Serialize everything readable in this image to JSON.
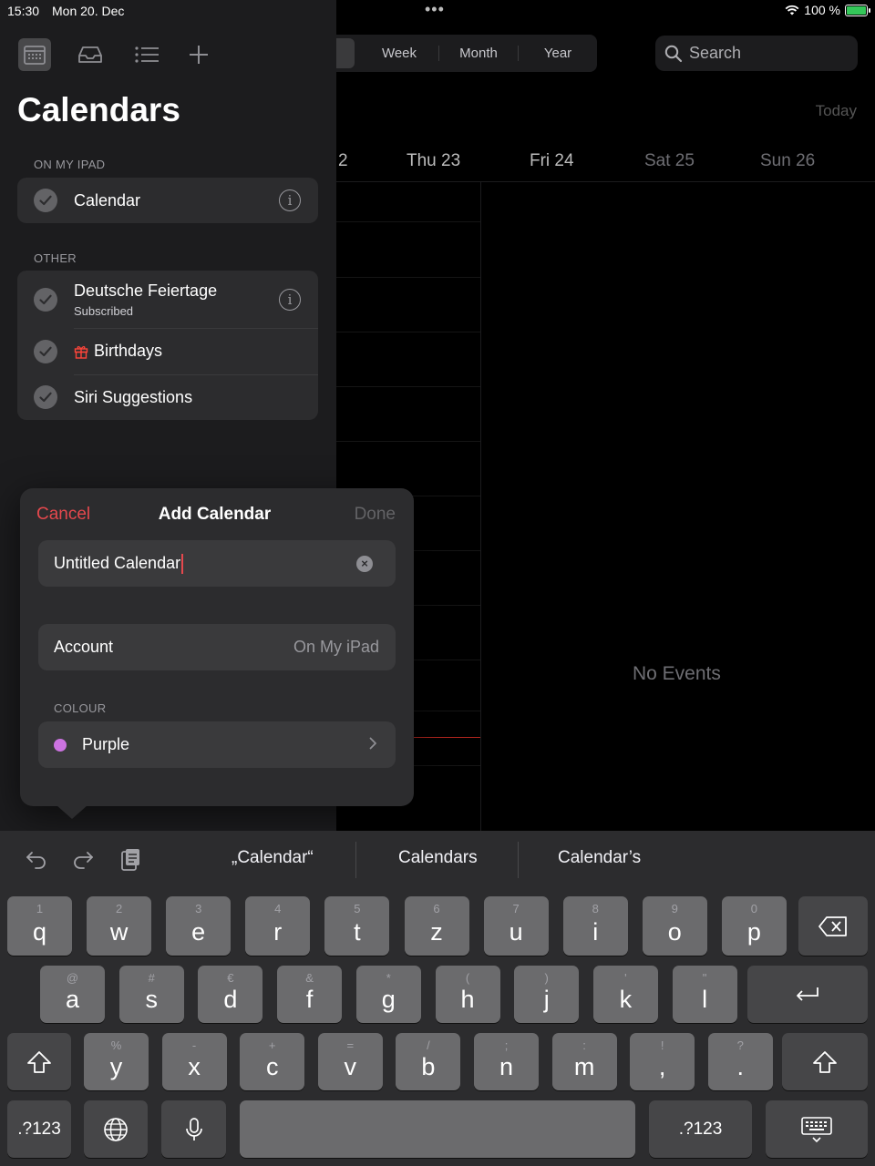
{
  "status": {
    "time": "15:30",
    "date": "Mon 20. Dec",
    "battery": "100 %",
    "battery_level": 1.0
  },
  "calendar": {
    "view_options": [
      "Week",
      "Month",
      "Year"
    ],
    "search_placeholder": "Search",
    "today_label": "Today",
    "partial_day": "2",
    "days": [
      "Thu 23",
      "Fri 24",
      "Sat 25",
      "Sun 26"
    ],
    "empty_text": "No Events"
  },
  "sidebar": {
    "title": "Calendars",
    "section_on_device": "ON MY IPAD",
    "on_device_items": [
      {
        "label": "Calendar"
      }
    ],
    "section_other": "OTHER",
    "other_items": [
      {
        "label": "Deutsche Feiertage",
        "sub": "Subscribed"
      },
      {
        "label": "Birthdays"
      },
      {
        "label": "Siri Suggestions"
      }
    ]
  },
  "popover": {
    "cancel": "Cancel",
    "title": "Add Calendar",
    "done": "Done",
    "name_value": "Untitled Calendar",
    "account_label": "Account",
    "account_value": "On My iPad",
    "colour_header": "COLOUR",
    "colour_name": "Purple",
    "colour_hex": "#cc73e1"
  },
  "keyboard": {
    "suggestions": [
      "„Calendar“",
      "Calendars",
      "Calendar’s"
    ],
    "row1": [
      {
        "k": "q",
        "a": "1"
      },
      {
        "k": "w",
        "a": "2"
      },
      {
        "k": "e",
        "a": "3"
      },
      {
        "k": "r",
        "a": "4"
      },
      {
        "k": "t",
        "a": "5"
      },
      {
        "k": "z",
        "a": "6"
      },
      {
        "k": "u",
        "a": "7"
      },
      {
        "k": "i",
        "a": "8"
      },
      {
        "k": "o",
        "a": "9"
      },
      {
        "k": "p",
        "a": "0"
      }
    ],
    "row2": [
      {
        "k": "a",
        "a": "@"
      },
      {
        "k": "s",
        "a": "#"
      },
      {
        "k": "d",
        "a": "€"
      },
      {
        "k": "f",
        "a": "&"
      },
      {
        "k": "g",
        "a": "*"
      },
      {
        "k": "h",
        "a": "("
      },
      {
        "k": "j",
        "a": ")"
      },
      {
        "k": "k",
        "a": "'"
      },
      {
        "k": "l",
        "a": "\""
      }
    ],
    "row3": [
      {
        "k": "y",
        "a": "%"
      },
      {
        "k": "x",
        "a": "-"
      },
      {
        "k": "c",
        "a": "+"
      },
      {
        "k": "v",
        "a": "="
      },
      {
        "k": "b",
        "a": "/"
      },
      {
        "k": "n",
        "a": ";"
      },
      {
        "k": "m",
        "a": ":"
      },
      {
        "k": ",",
        "a": "!"
      },
      {
        "k": ".",
        "a": "?"
      }
    ],
    "numbers_label": ".?123"
  }
}
